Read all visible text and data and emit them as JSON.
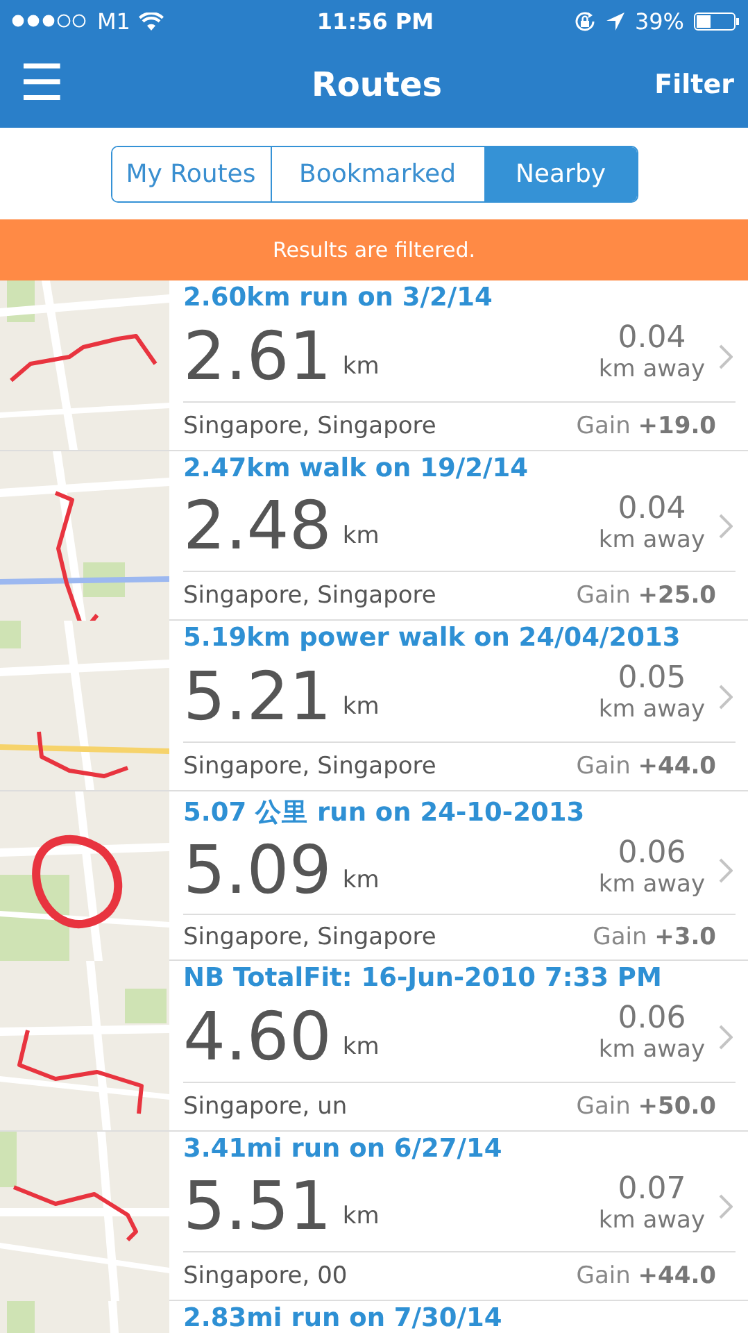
{
  "status_bar": {
    "carrier": "M1",
    "time": "11:56 PM",
    "battery": "39%"
  },
  "nav_bar": {
    "menu_icon": "☰",
    "title": "Routes",
    "action": "Filter"
  },
  "tabs": [
    {
      "label": "My Routes",
      "selected": false
    },
    {
      "label": "Bookmarked",
      "selected": false
    },
    {
      "label": "Nearby",
      "selected": true
    }
  ],
  "banner": "Results are filtered.",
  "routes": [
    {
      "title": "2.60km run on 3/2/14",
      "distance": "2.61",
      "unit": "km",
      "away": "0.04",
      "away_unit": "km away",
      "location": "Singapore, Singapore",
      "gain": "Gain **+19.0**"
    },
    {
      "title": "2.47km walk on 19/2/14",
      "distance": "2.48",
      "unit": "km",
      "away": "0.04",
      "away_unit": "km away",
      "location": "Singapore, Singapore",
      "gain": "Gain **+25.0**"
    },
    {
      "title": "5.19km power walk on 24/04/2013",
      "distance": "5.21",
      "unit": "km",
      "away": "0.05",
      "away_unit": "km away",
      "location": "Singapore, Singapore",
      "gain": "Gain **+44.0**"
    },
    {
      "title": "5.07 公里 run on 24-10-2013",
      "distance": "5.09",
      "unit": "km",
      "away": "0.06",
      "away_unit": "km away",
      "location": "Singapore, Singapore",
      "gain": "Gain **+3.0**"
    },
    {
      "title": "NB TotalFit: 16-Jun-2010 7:33 PM",
      "distance": "4.60",
      "unit": "km",
      "away": "0.06",
      "away_unit": "km away",
      "location": "Singapore, un",
      "gain": "Gain **+50.0**"
    },
    {
      "title": "3.41mi run on 6/27/14",
      "distance": "5.51",
      "unit": "km",
      "away": "0.07",
      "away_unit": "km away",
      "location": "Singapore, 00",
      "gain": "Gain **+44.0**"
    },
    {
      "title": "2.83mi run on 7/30/14"
    }
  ]
}
